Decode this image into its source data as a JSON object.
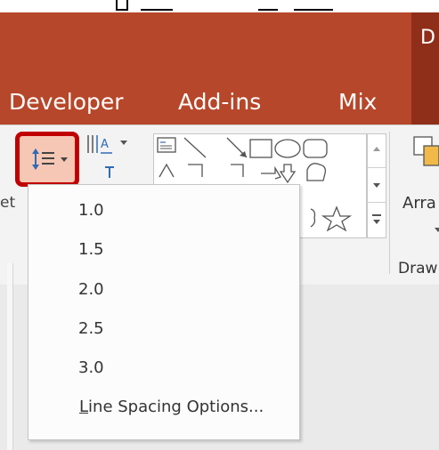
{
  "ribbon": {
    "tabs": [
      {
        "label": "Developer"
      },
      {
        "label": "Add-ins"
      },
      {
        "label": "Mix"
      },
      {
        "label": "D"
      }
    ],
    "arrange_label": "Arra",
    "drawing_label": "Draw",
    "left_edge_text": "et"
  },
  "line_spacing_menu": {
    "items": [
      {
        "label": "1.0"
      },
      {
        "label": "1.5"
      },
      {
        "label": "2.0"
      },
      {
        "label": "2.5"
      },
      {
        "label": "3.0"
      }
    ],
    "options_label_first": "L",
    "options_label_rest": "ine Spacing Options..."
  },
  "colors": {
    "ribbon_orange": "#b7472a",
    "ribbon_dark": "#8f2f19",
    "highlight_red": "#c00000",
    "button_pressed": "#f6c7b4"
  },
  "icons": {
    "line_spacing": "line-spacing-icon",
    "text_direction": "text-direction-icon",
    "align_text": "align-text-icon",
    "arrange": "arrange-icon"
  }
}
